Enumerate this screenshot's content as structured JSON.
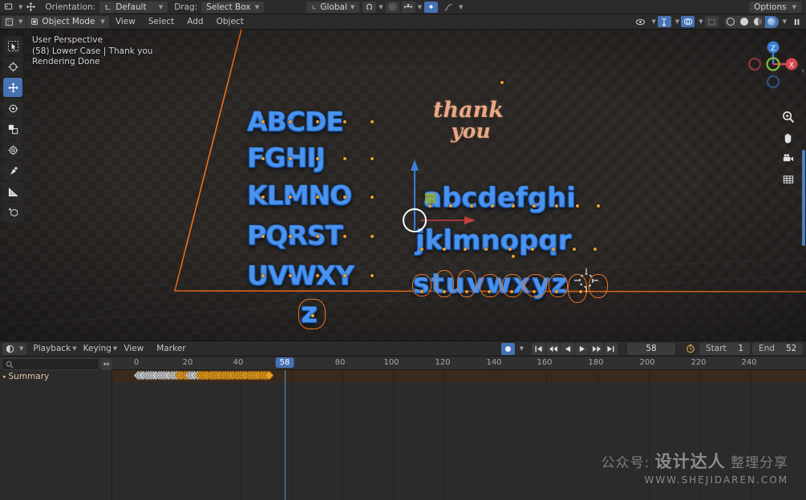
{
  "topbar": {
    "editor_icon": "editor-type-icon",
    "transform_icon": "move-tool-icon",
    "orientation_label": "Orientation:",
    "orientation_value": "Default",
    "drag_label": "Drag:",
    "drag_value": "Select Box",
    "global_value": "Global",
    "snap_icon": "magnet-icon",
    "proportional_icon": "proportional-edit-icon",
    "pivot_icon": "pivot-point-icon",
    "mirror_icon": "mirror-x-icon",
    "falloff_icon": "falloff-curve-icon",
    "options_label": "Options"
  },
  "viewport_header": {
    "editor_icon": "3d-viewport-icon",
    "mode": "Object Mode",
    "menus": [
      "View",
      "Select",
      "Add",
      "Object"
    ],
    "visibility_icon": "visibility-icon",
    "gizmo_icon": "gizmo-icon",
    "overlays_icon": "overlays-icon",
    "xray_icon": "x-ray-icon",
    "shading": [
      "wireframe",
      "solid",
      "material-preview",
      "rendered"
    ],
    "shading_active": "rendered",
    "pause_icon": "pause-icon"
  },
  "viewport": {
    "info_lines": [
      "User Perspective",
      "(58) Lower Case | Thank you",
      "Rendering Done"
    ],
    "tools": [
      {
        "name": "tweak-select-box-tool",
        "icon": "select-box-icon",
        "active": false
      },
      {
        "name": "cursor-tool",
        "icon": "cursor-icon",
        "active": false
      },
      {
        "name": "move-tool",
        "icon": "move-icon",
        "active": true
      },
      {
        "name": "rotate-tool",
        "icon": "rotate-icon",
        "active": false
      },
      {
        "name": "scale-tool",
        "icon": "scale-icon",
        "active": false
      },
      {
        "name": "transform-tool",
        "icon": "transform-icon",
        "active": false
      },
      {
        "name": "annotate-tool",
        "icon": "annotate-icon",
        "active": false
      },
      {
        "name": "measure-tool",
        "icon": "measure-icon",
        "active": false
      },
      {
        "name": "add-cube-tool",
        "icon": "add-cube-icon",
        "active": false
      }
    ],
    "gizmo_axes": [
      {
        "label": "Z",
        "color": "#3b7fd4"
      },
      {
        "label": "X",
        "color": "#d6484a"
      },
      {
        "label": "Y",
        "color": "#7cc13a"
      }
    ],
    "nav_icons": [
      "zoom-icon",
      "pan-hand-icon",
      "camera-icon",
      "grid-orthographic-icon"
    ],
    "uppercase_rows": [
      "ABCDE",
      "FGHIJ",
      "KLMNO",
      "PQRST",
      "UVWXY"
    ],
    "lowercase_rows": [
      "abcdefghi",
      "jklmnopqr",
      "stuvwxyz"
    ],
    "extra_glyph": "z",
    "script_text_line1": "thank",
    "script_text_line2": "you",
    "letter_color": "#1f6ddb",
    "script_color": "#e9a985",
    "selection_color": "#e8762a",
    "origin_color": "#f0a030"
  },
  "timeline": {
    "editor_icon": "timeline-editor-icon",
    "menus": [
      "Playback",
      "Keying",
      "View",
      "Marker"
    ],
    "record_icon": "auto-keying-icon",
    "playback_buttons": [
      "jump-to-start-icon",
      "jump-to-keyframe-prev-icon",
      "play-reverse-icon",
      "play-icon",
      "jump-to-keyframe-next-icon",
      "jump-to-end-icon"
    ],
    "current_frame": "58",
    "clock_icon": "use-preview-range-icon",
    "start_label": "Start",
    "start_value": "1",
    "end_label": "End",
    "end_value": "52",
    "search_placeholder": "",
    "search_icon": "search-icon",
    "expand_icon": "expand-horizontal-icon",
    "channel_name": "Summary",
    "ruler_ticks": [
      "0",
      "20",
      "40",
      "80",
      "100",
      "120",
      "140",
      "160",
      "180",
      "200",
      "220",
      "240"
    ],
    "keyframe_count": 52
  },
  "watermark": {
    "line1_prefix": "公众号: ",
    "line1_brand": "设计达人",
    "line1_suffix": " 整理分享",
    "line2": "WWW.SHEJIDAREN.COM"
  }
}
